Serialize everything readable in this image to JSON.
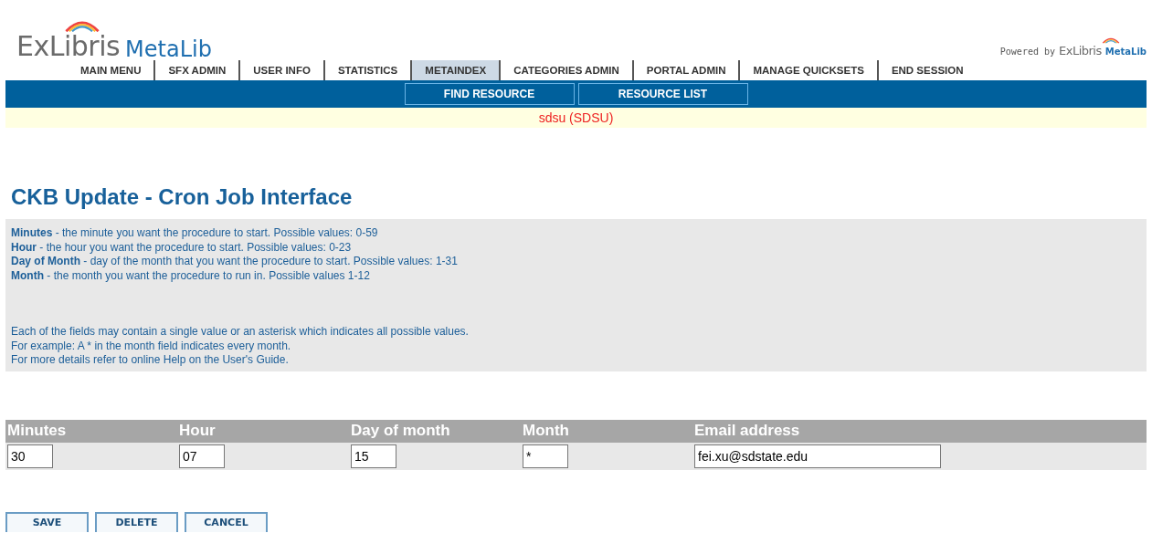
{
  "logo": {
    "brand": "ExLibris",
    "product": "MetaLib"
  },
  "powered_by": {
    "label": "Powered by",
    "brand": "ExLibris",
    "product": "MetaLib"
  },
  "main_nav": [
    {
      "label": "MAIN MENU",
      "selected": false
    },
    {
      "label": "SFX ADMIN",
      "selected": false
    },
    {
      "label": "USER INFO",
      "selected": false
    },
    {
      "label": "STATISTICS",
      "selected": false
    },
    {
      "label": "METAINDEX",
      "selected": true
    },
    {
      "label": "CATEGORIES ADMIN",
      "selected": false
    },
    {
      "label": "PORTAL ADMIN",
      "selected": false
    },
    {
      "label": "MANAGE QUICKSETS",
      "selected": false
    },
    {
      "label": "END SESSION",
      "selected": false
    }
  ],
  "sub_nav": [
    "FIND RESOURCE",
    "RESOURCE LIST"
  ],
  "institution": "sdsu (SDSU)",
  "title": "CKB Update - Cron Job Interface",
  "help": {
    "definitions": [
      "**Minutes** - the minute you want the procedure to start. Possible values: 0-59",
      "**Hour** - the hour you want the procedure to start. Possible values: 0-23",
      "**Day of Month** - day of the month that you want the procedure to start. Possible values: 1-31",
      "**Month** - the month you want the procedure to run in. Possible values 1-12"
    ],
    "notes": [
      "Each of the fields may contain a single value or an asterisk which indicates all possible values.",
      "For example: A * in the month field indicates every month.",
      "For more details refer to online Help on the User's Guide."
    ]
  },
  "form": {
    "columns": [
      {
        "label": "Minutes",
        "value": "30",
        "kind": "short"
      },
      {
        "label": "Hour",
        "value": "07",
        "kind": "short"
      },
      {
        "label": "Day of month",
        "value": "15",
        "kind": "short"
      },
      {
        "label": "Month",
        "value": "*",
        "kind": "short"
      },
      {
        "label": "Email address",
        "value": "fei.xu@sdstate.edu",
        "kind": "wide"
      }
    ]
  },
  "buttons": [
    "SAVE",
    "DELETE",
    "CANCEL"
  ]
}
